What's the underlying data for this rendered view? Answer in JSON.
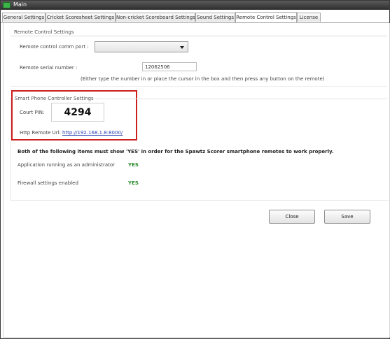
{
  "window": {
    "title": "Main"
  },
  "tabs": [
    {
      "label": "General Settings",
      "active": false
    },
    {
      "label": "Cricket Scoresheet Settings",
      "active": false
    },
    {
      "label": "Non-cricket Scoreboard Settings",
      "active": false
    },
    {
      "label": "Sound Settings",
      "active": false
    },
    {
      "label": "Remote Control Settings",
      "active": true
    },
    {
      "label": "License",
      "active": false
    }
  ],
  "remote_control": {
    "section_title": "Remote Control Settings",
    "comm_port_label": "Remote control comm port :",
    "comm_port_value": "",
    "serial_label": "Remote serial number :",
    "serial_value": "12062506",
    "serial_hint": "(Either type the number in or place the cursor in the box and then press any button on the remote)"
  },
  "smartphone": {
    "section_title": "Smart Phone Controller Settings",
    "pin_label": "Court PIN:",
    "pin_value": "4294",
    "url_label": "Http Remote Url:",
    "url_value": "http://192.168.1.8:8000/"
  },
  "requirements": {
    "notice": "Both of the following items must show 'YES' in order for the Spawtz Scorer smartphone remotes to work properly.",
    "items": [
      {
        "label": "Application running as an administrator",
        "status": "YES"
      },
      {
        "label": "Firewall settings enabled",
        "status": "YES"
      }
    ]
  },
  "buttons": {
    "close": "Close",
    "save": "Save"
  },
  "colors": {
    "highlight_box": "#cc1f1f",
    "status_yes": "#2a8a2a",
    "link": "#2a3fb0"
  }
}
